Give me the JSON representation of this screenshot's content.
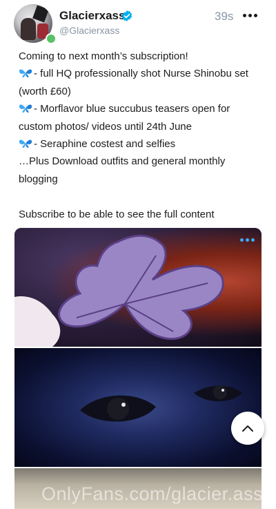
{
  "post_header": {
    "name": "Glacierxass",
    "handle": "@Glacierxass",
    "time": "39s",
    "online": true
  },
  "post_body": {
    "lines": [
      "Coming to next month’s subscription!",
      "- full HQ professionally shot Nurse Shinobu set",
      "(worth £60)",
      "- Morflavor blue succubus teasers open for",
      "custom photos/ videos until 24th June",
      "- Seraphine costest and selfies",
      "…Plus Download outfits and general monthly",
      "blogging",
      "",
      "Subscribe to be able to see the full content"
    ],
    "bullet_icon": "butterfly-icon"
  },
  "media": {
    "watermark": "OnlyFans.com/glacier.ass"
  },
  "colors": {
    "accent": "#00aff0",
    "verified": "#00aff0",
    "online": "#59c266",
    "muted": "#8a96a3"
  },
  "icons": {
    "more": "more-horizontal-icon",
    "verified": "verified-badge-icon",
    "scroll_top": "chevron-up-icon"
  }
}
